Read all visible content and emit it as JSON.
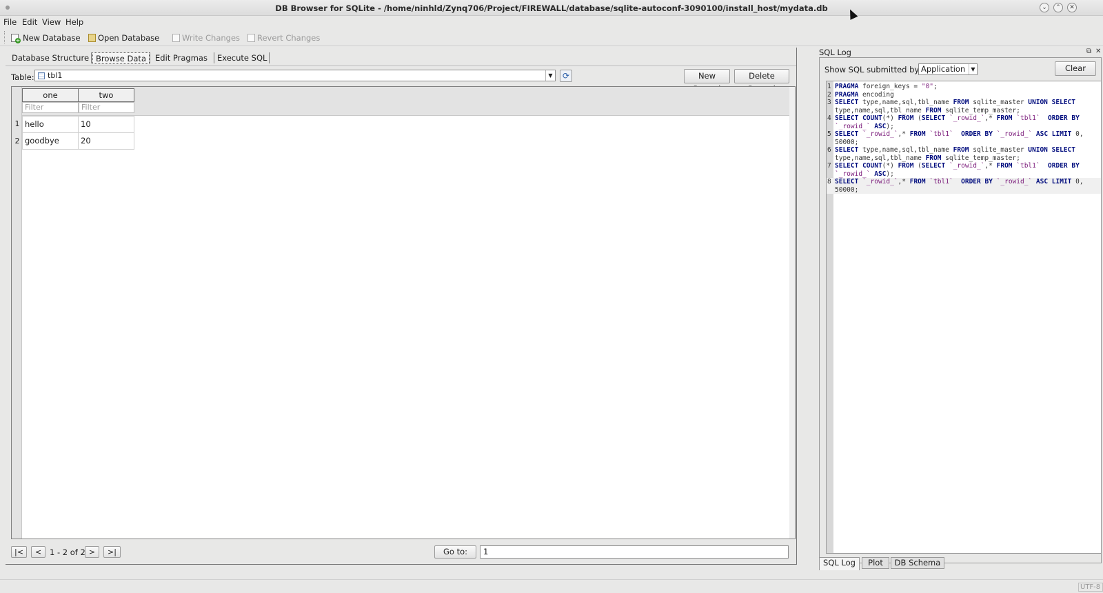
{
  "window": {
    "title": "DB Browser for SQLite - /home/ninhld/Zynq706/Project/FIREWALL/database/sqlite-autoconf-3090100/install_host/mydata.db"
  },
  "menu": [
    "File",
    "Edit",
    "View",
    "Help"
  ],
  "toolbar": {
    "new_db": "New Database",
    "open_db": "Open Database",
    "write": "Write Changes",
    "revert": "Revert Changes"
  },
  "tabs": [
    "Database Structure",
    "Browse Data",
    "Edit Pragmas",
    "Execute SQL"
  ],
  "browse": {
    "table_label": "Table:",
    "table_value": "tbl1",
    "new_record": "New Record",
    "delete_record": "Delete Record",
    "columns": [
      "one",
      "two"
    ],
    "filter_placeholder": "Filter",
    "rows": [
      {
        "num": "1",
        "one": "hello",
        "two": "10"
      },
      {
        "num": "2",
        "one": "goodbye",
        "two": "20"
      }
    ],
    "nav": {
      "first": "|<",
      "prev": "<",
      "status": "1 - 2 of 2",
      "next": ">",
      "last": ">|"
    },
    "goto_label": "Go to:",
    "goto_value": "1"
  },
  "sqllog": {
    "title": "SQL Log",
    "show_label": "Show SQL submitted by",
    "submitter": "Application",
    "clear": "Clear",
    "lines": [
      {
        "n": "1",
        "text": "PRAGMA foreign_keys = \"0\";"
      },
      {
        "n": "2",
        "text": "PRAGMA encoding"
      },
      {
        "n": "3",
        "text": "SELECT type,name,sql,tbl_name FROM sqlite_master UNION SELECT type,name,sql,tbl_name FROM sqlite_temp_master;"
      },
      {
        "n": "4",
        "text": "SELECT COUNT(*) FROM (SELECT `_rowid_`,* FROM `tbl1`  ORDER BY `_rowid_` ASC);"
      },
      {
        "n": "5",
        "text": "SELECT `_rowid_`,* FROM `tbl1`  ORDER BY `_rowid_` ASC LIMIT 0, 50000;"
      },
      {
        "n": "6",
        "text": "SELECT type,name,sql,tbl_name FROM sqlite_master UNION SELECT type,name,sql,tbl_name FROM sqlite_temp_master;"
      },
      {
        "n": "7",
        "text": "SELECT COUNT(*) FROM (SELECT `_rowid_`,* FROM `tbl1`  ORDER BY `_rowid_` ASC);"
      },
      {
        "n": "8",
        "text": "SELECT `_rowid_`,* FROM `tbl1`  ORDER BY `_rowid_` ASC LIMIT 0, 50000;"
      }
    ],
    "tabs": [
      "SQL Log",
      "Plot",
      "DB Schema"
    ]
  },
  "status": {
    "encoding": "UTF-8"
  },
  "colors": {
    "keyword": "#000c7e",
    "string": "#7a1a7a",
    "background": "#e8e8e7"
  },
  "icons": [
    "new-database-icon",
    "open-database-icon",
    "write-changes-icon",
    "revert-changes-icon",
    "table-icon",
    "refresh-icon"
  ]
}
